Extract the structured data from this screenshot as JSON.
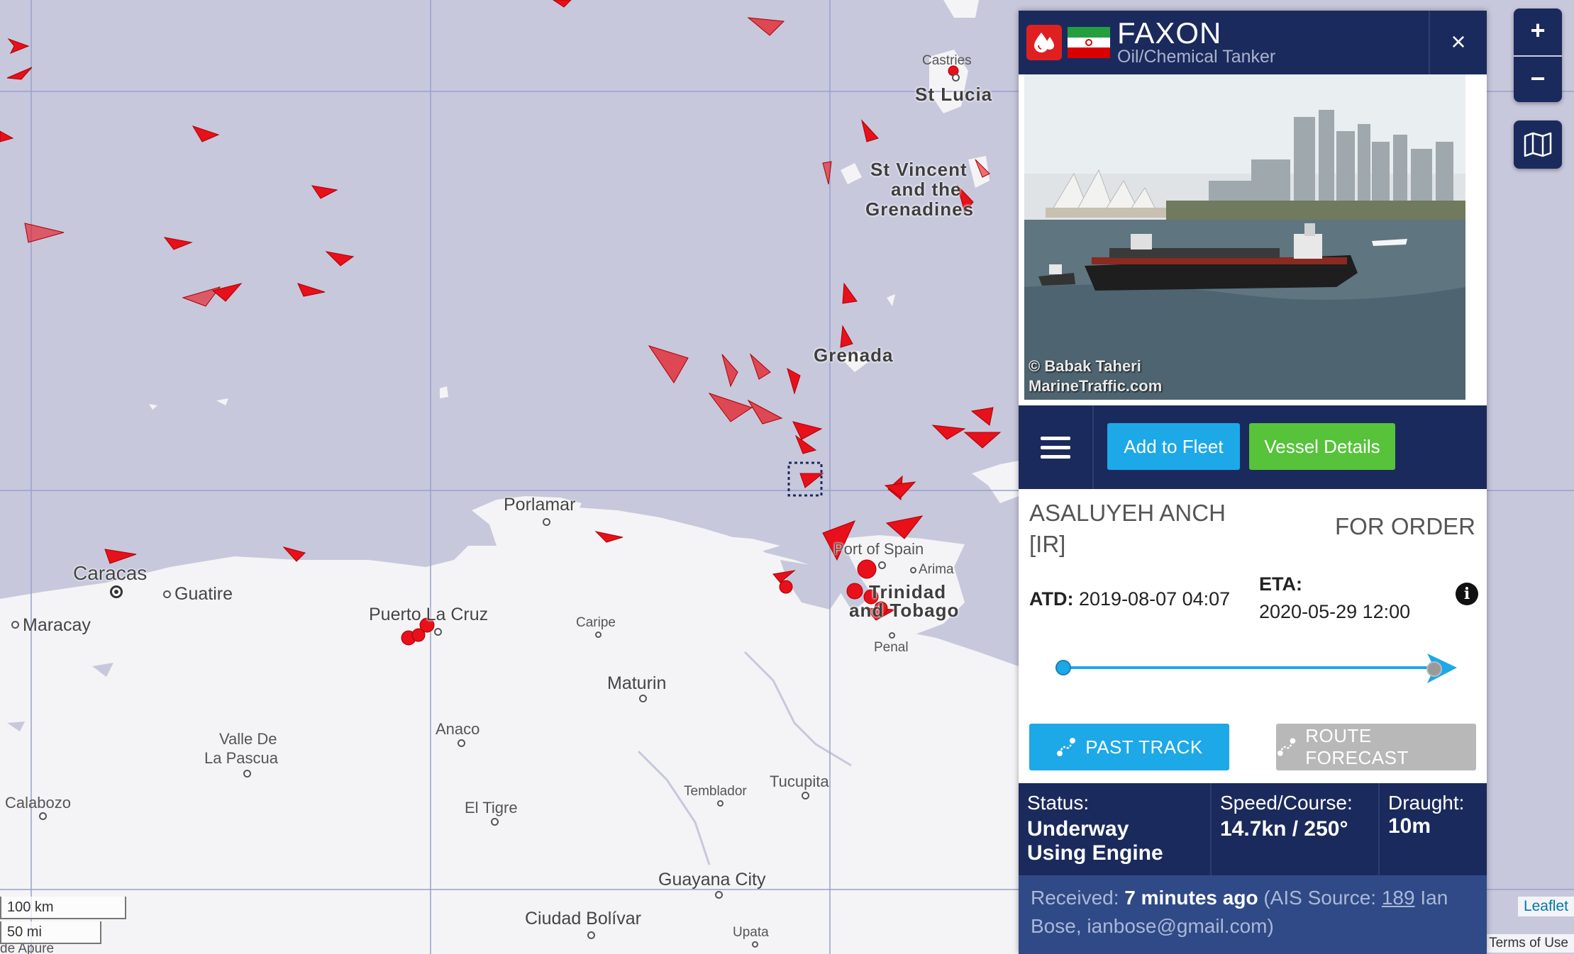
{
  "map": {
    "places": {
      "castries": "Castries",
      "st_lucia": "St Lucia",
      "st_vincent_1": "St Vincent",
      "st_vincent_2": "and the",
      "st_vincent_3": "Grenadines",
      "grenada": "Grenada",
      "porlamar": "Porlamar",
      "port_of_spain": "Port of Spain",
      "arima": "Arima",
      "trinidad_1": "Trinidad",
      "trinidad_2": "and Tobago",
      "penal": "Penal",
      "caracas": "Caracas",
      "guatire": "Guatire",
      "maracay": "Maracay",
      "puerto_la_cruz": "Puerto La Cruz",
      "caripe": "Caripe",
      "maturin": "Maturin",
      "valle_1": "Valle De",
      "valle_2": "La Pascua",
      "anaco": "Anaco",
      "calabozo": "Calabozo",
      "el_tigre": "El Tigre",
      "temblador": "Temblador",
      "tucupita": "Tucupita",
      "guayana_city": "Guayana City",
      "ciudad_bolivar": "Ciudad Bolívar",
      "upata": "Upata",
      "de_apure": "de Apure"
    },
    "scale_km": "100 km",
    "scale_mi": "50 mi",
    "attribution": "Leaflet",
    "terms": "Terms of Use",
    "coord_peek": ")",
    "colors": {
      "sea": "#c7c8dc",
      "land": "#f4f4f6",
      "ship": "#e8101a",
      "grid": "#9aa0cc"
    }
  },
  "controls": {
    "zoom_in": "+",
    "zoom_out": "−",
    "layers_icon": "map-layers-icon"
  },
  "vessel": {
    "name": "FAXON",
    "type": "Oil/Chemical Tanker",
    "flag": "Iran",
    "close": "×",
    "photo_credit_1": "© Babak Taheri",
    "photo_credit_2": "MarineTraffic.com",
    "add_to_fleet": "Add to Fleet",
    "vessel_details": "Vessel Details",
    "from_port": "ASALUYEH ANCH [IR]",
    "destination": "FOR ORDER",
    "atd_label": "ATD:",
    "atd_value": "2019-08-07 04:07",
    "eta_label": "ETA:",
    "eta_value": "2020-05-29 12:00",
    "past_track": "PAST TRACK",
    "route_forecast": "ROUTE FORECAST",
    "status_label": "Status:",
    "status_value": "Underway Using Engine",
    "speed_label": "Speed/Course:",
    "speed_value": "14.7kn / 250°",
    "draught_label": "Draught:",
    "draught_value": "10m",
    "received_label": "Received:",
    "received_value": "7 minutes ago",
    "ais_prefix": "(AIS Source:",
    "ais_id": "189",
    "ais_suffix": "Ian Bose, ianbose@gmail.com)",
    "colors": {
      "header": "#1b2a5c",
      "accent_blue": "#1da8e8",
      "accent_green": "#56c33a",
      "tanker_red": "#e02020"
    }
  }
}
